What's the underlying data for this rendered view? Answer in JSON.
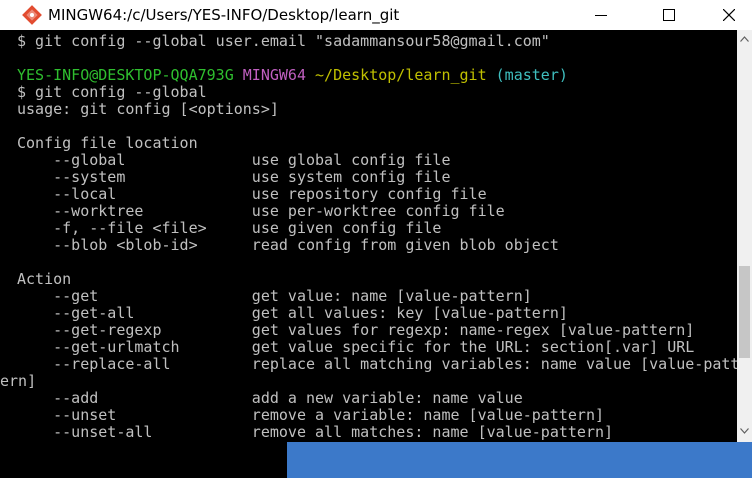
{
  "window": {
    "title": "MINGW64:/c/Users/YES-INFO/Desktop/learn_git"
  },
  "prompt": {
    "user_host": "YES-INFO@DESKTOP-QQA793G",
    "shell": "MINGW64",
    "path": "~/Desktop/learn_git",
    "branch": "(master)"
  },
  "terminal": {
    "prev_command": "$ git config --global user.email \"sadammansour58@gmail.com\"",
    "command": "$ git config --global",
    "usage": "usage: git config [<options>]",
    "section_config_file": "Config file location",
    "config_options": [
      "    --global              use global config file",
      "    --system              use system config file",
      "    --local               use repository config file",
      "    --worktree            use per-worktree config file",
      "    -f, --file <file>     use given config file",
      "    --blob <blob-id>      read config from given blob object"
    ],
    "section_action": "Action",
    "action_options": [
      "    --get                 get value: name [value-pattern]",
      "    --get-all             get all values: key [value-pattern]",
      "    --get-regexp          get values for regexp: name-regex [value-pattern]",
      "    --get-urlmatch        get value specific for the URL: section[.var] URL",
      "    --replace-all         replace all matching variables: name value [value-patt",
      "ern]",
      "    --add                 add a new variable: name value",
      "    --unset               remove a variable: name [value-pattern]",
      "    --unset-all           remove all matches: name [value-pattern]"
    ]
  }
}
